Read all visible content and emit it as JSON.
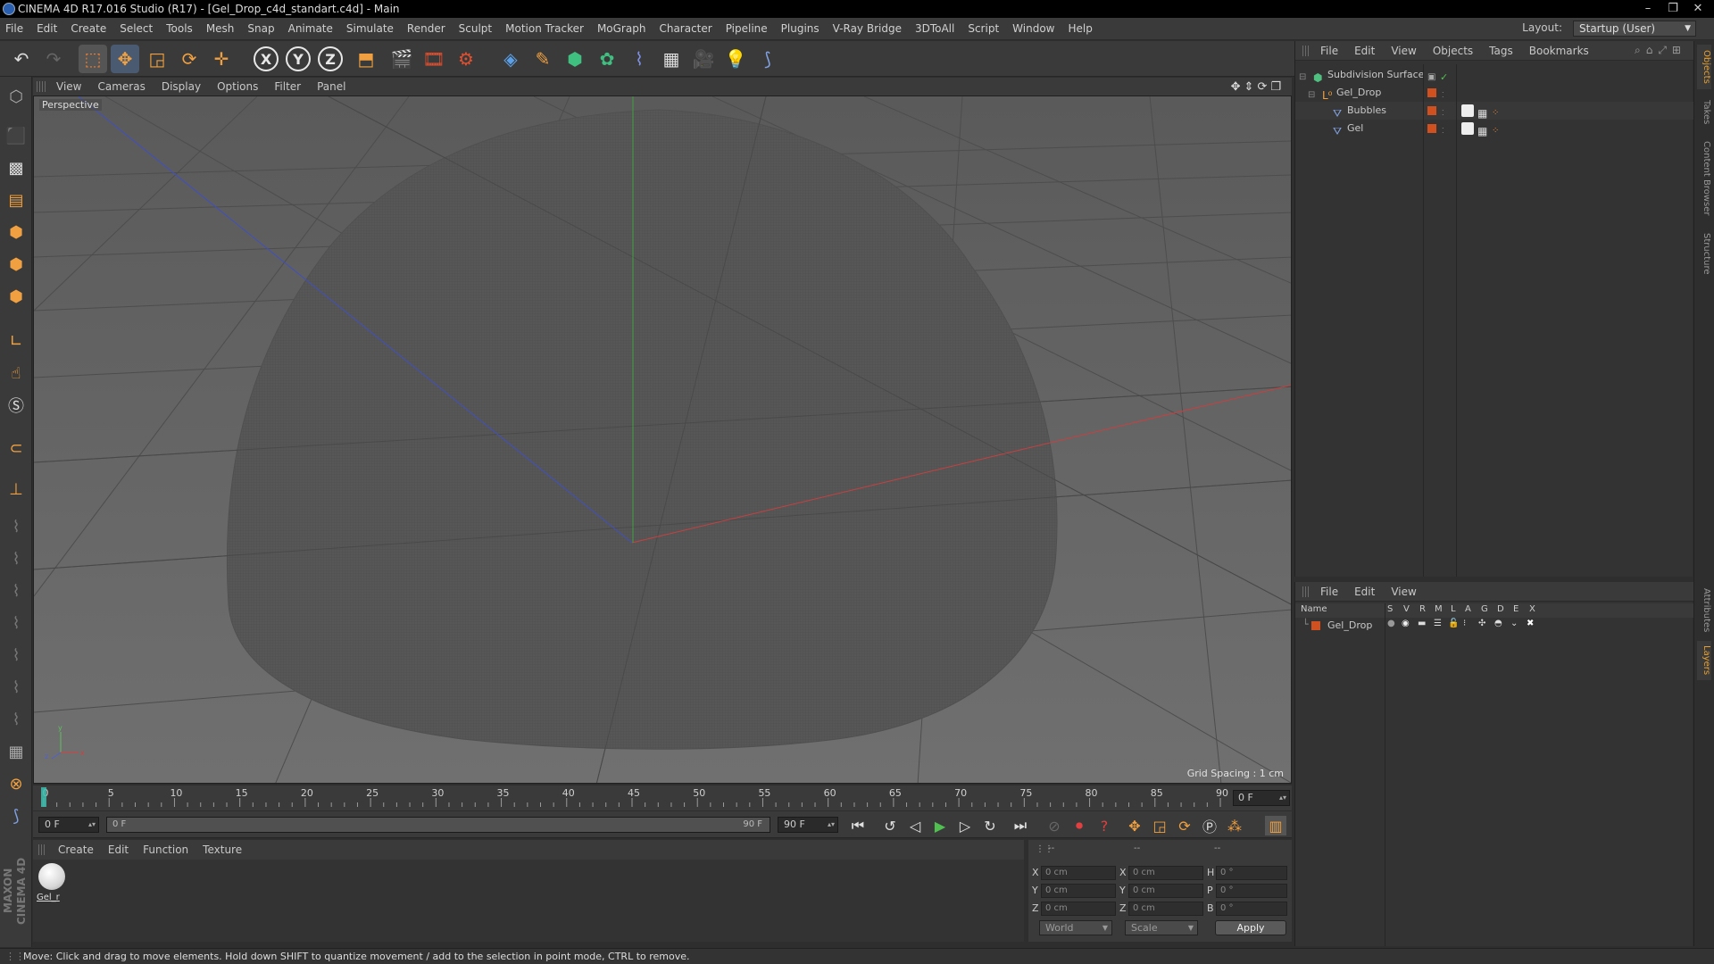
{
  "window": {
    "title": "CINEMA 4D R17.016 Studio (R17) - [Gel_Drop_c4d_standart.c4d] - Main",
    "controls": [
      "–",
      "❐",
      "✕"
    ]
  },
  "menubar": {
    "items": [
      "File",
      "Edit",
      "Create",
      "Select",
      "Tools",
      "Mesh",
      "Snap",
      "Animate",
      "Simulate",
      "Render",
      "Sculpt",
      "Motion Tracker",
      "MoGraph",
      "Character",
      "Pipeline",
      "Plugins",
      "V-Ray Bridge",
      "3DToAll",
      "Script",
      "Window",
      "Help"
    ],
    "layout_label": "Layout:",
    "layout_value": "Startup (User)"
  },
  "toolbar": {
    "axis_x": "X",
    "axis_y": "Y",
    "axis_z": "Z"
  },
  "viewport": {
    "menu": [
      "View",
      "Cameras",
      "Display",
      "Options",
      "Filter",
      "Panel"
    ],
    "label": "Perspective",
    "grid_spacing": "Grid Spacing : 1 cm",
    "axis_x_color": "#c84040",
    "axis_y_color": "#40a040",
    "axis_z_color": "#4050c0"
  },
  "timeline": {
    "ticks": [
      "0",
      "5",
      "10",
      "15",
      "20",
      "25",
      "30",
      "35",
      "40",
      "45",
      "50",
      "55",
      "60",
      "65",
      "70",
      "75",
      "80",
      "85",
      "90"
    ],
    "current_frame": "0 F",
    "start_field": "0 F",
    "range_start": "0 F",
    "range_end": "90 F",
    "end_field": "90 F"
  },
  "materials": {
    "menu": [
      "Create",
      "Edit",
      "Function",
      "Texture"
    ],
    "items": [
      {
        "name": "Gel_r"
      }
    ]
  },
  "coordinates": {
    "header": [
      "--",
      "--",
      "--"
    ],
    "rows": [
      {
        "axis": "X",
        "pos": "0 cm",
        "axis2": "X",
        "size": "0 cm",
        "rot_axis": "H",
        "rot": "0 °"
      },
      {
        "axis": "Y",
        "pos": "0 cm",
        "axis2": "Y",
        "size": "0 cm",
        "rot_axis": "P",
        "rot": "0 °"
      },
      {
        "axis": "Z",
        "pos": "0 cm",
        "axis2": "Z",
        "size": "0 cm",
        "rot_axis": "B",
        "rot": "0 °"
      }
    ],
    "mode": "World",
    "scale_mode": "Scale",
    "apply": "Apply"
  },
  "objects": {
    "menu": [
      "File",
      "Edit",
      "View",
      "Objects",
      "Tags",
      "Bookmarks"
    ],
    "tree": [
      {
        "name": "Subdivision Surface",
        "indent": 0
      },
      {
        "name": "Gel_Drop",
        "indent": 1
      },
      {
        "name": "Bubbles",
        "indent": 2
      },
      {
        "name": "Gel",
        "indent": 2
      }
    ]
  },
  "layers": {
    "menu": [
      "File",
      "Edit",
      "View"
    ],
    "columns": [
      "Name",
      "S",
      "V",
      "R",
      "M",
      "L",
      "A",
      "G",
      "D",
      "E",
      "X"
    ],
    "rows": [
      {
        "name": "Gel_Drop",
        "color": "#d05020"
      }
    ]
  },
  "side_tabs": [
    "Objects",
    "Takes",
    "Content Browser",
    "Structure",
    "Attributes",
    "Layers"
  ],
  "status": "Move: Click and drag to move elements. Hold down SHIFT to quantize movement / add to the selection in point mode, CTRL to remove.",
  "brand": "MAXON CINEMA 4D",
  "colors": {
    "accent_orange": "#e8a030",
    "object_tag_orange": "#d05020"
  }
}
